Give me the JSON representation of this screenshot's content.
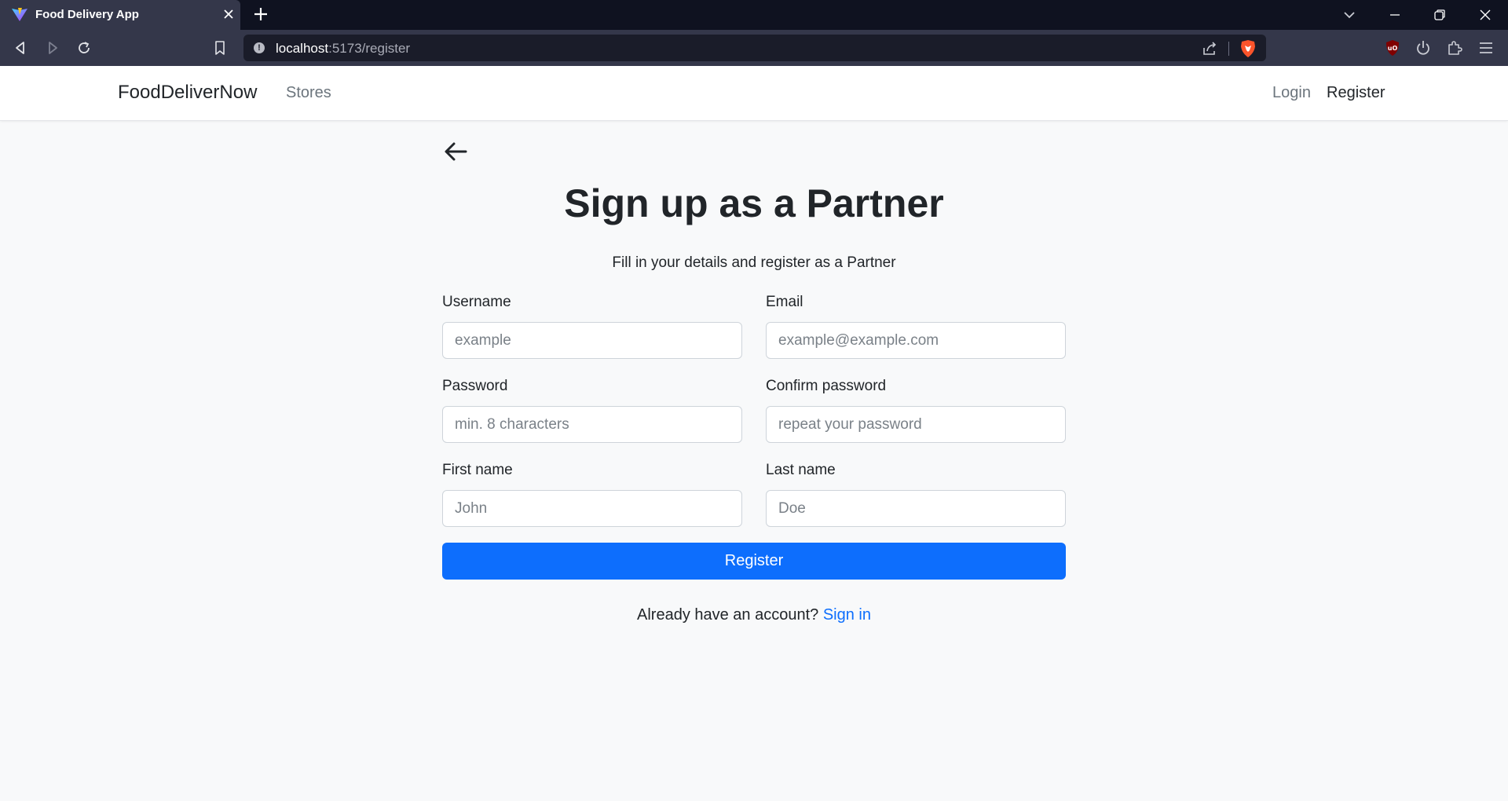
{
  "browser": {
    "tab_title": "Food Delivery App",
    "url_host": "localhost",
    "url_path": ":5173/register"
  },
  "navbar": {
    "brand": "FoodDeliverNow",
    "links": {
      "stores": "Stores",
      "login": "Login",
      "register": "Register"
    }
  },
  "form": {
    "title": "Sign up as a Partner",
    "subtitle": "Fill in your details and register as a Partner",
    "fields": {
      "username": {
        "label": "Username",
        "placeholder": "example",
        "value": ""
      },
      "email": {
        "label": "Email",
        "placeholder": "example@example.com",
        "value": ""
      },
      "password": {
        "label": "Password",
        "placeholder": "min. 8 characters",
        "value": ""
      },
      "confirm_password": {
        "label": "Confirm password",
        "placeholder": "repeat your password",
        "value": ""
      },
      "first_name": {
        "label": "First name",
        "placeholder": "John",
        "value": ""
      },
      "last_name": {
        "label": "Last name",
        "placeholder": "Doe",
        "value": ""
      }
    },
    "submit_label": "Register",
    "signin_prompt": "Already have an account?",
    "signin_link": "Sign in"
  },
  "colors": {
    "primary": "#0d6efd",
    "page_background": "#f8f9fa",
    "browser_chrome": "#34374a"
  },
  "icons": {
    "back": "arrow-left-icon",
    "favicon": "vite-logo-icon"
  }
}
